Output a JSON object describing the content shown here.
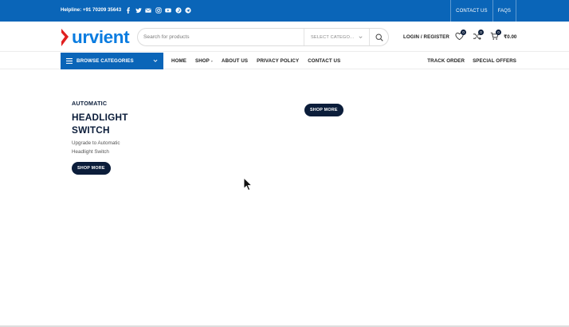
{
  "topbar": {
    "helpline": "Helpline: +91 70209 35643",
    "social_icons": [
      "facebook-icon",
      "twitter-icon",
      "email-icon",
      "instagram-icon",
      "youtube-icon",
      "pinterest-icon",
      "telegram-icon"
    ],
    "links": [
      "CONTACT US",
      "FAQS"
    ]
  },
  "header": {
    "logo_text": "urvient",
    "search_placeholder": "Search for products",
    "category_select": "SELECT CATEGO...",
    "login": "LOGIN / REGISTER",
    "wishlist_count": "0",
    "compare_count": "0",
    "cart_count": "0",
    "cart_total": "₹0.00"
  },
  "nav": {
    "browse_label": "BROWSE CATEGORIES",
    "links": [
      "HOME",
      "SHOP",
      "ABOUT US",
      "PRIVACY POLICY",
      "CONTACT US"
    ],
    "right_links": [
      "TRACK ORDER",
      "SPECIAL OFFERS"
    ]
  },
  "hero": {
    "eyebrow": "AUTOMATIC",
    "title": "HEADLIGHT SWITCH",
    "subtitle": "Upgrade to Automatic Headlight Switch",
    "button": "SHOP MORE",
    "button_2": "SHOP MORE"
  },
  "colors": {
    "primary_blue": "#0a65b8",
    "logo_blue": "#0a7ce0",
    "logo_red": "#e02020",
    "navy": "#0b1d3a"
  }
}
